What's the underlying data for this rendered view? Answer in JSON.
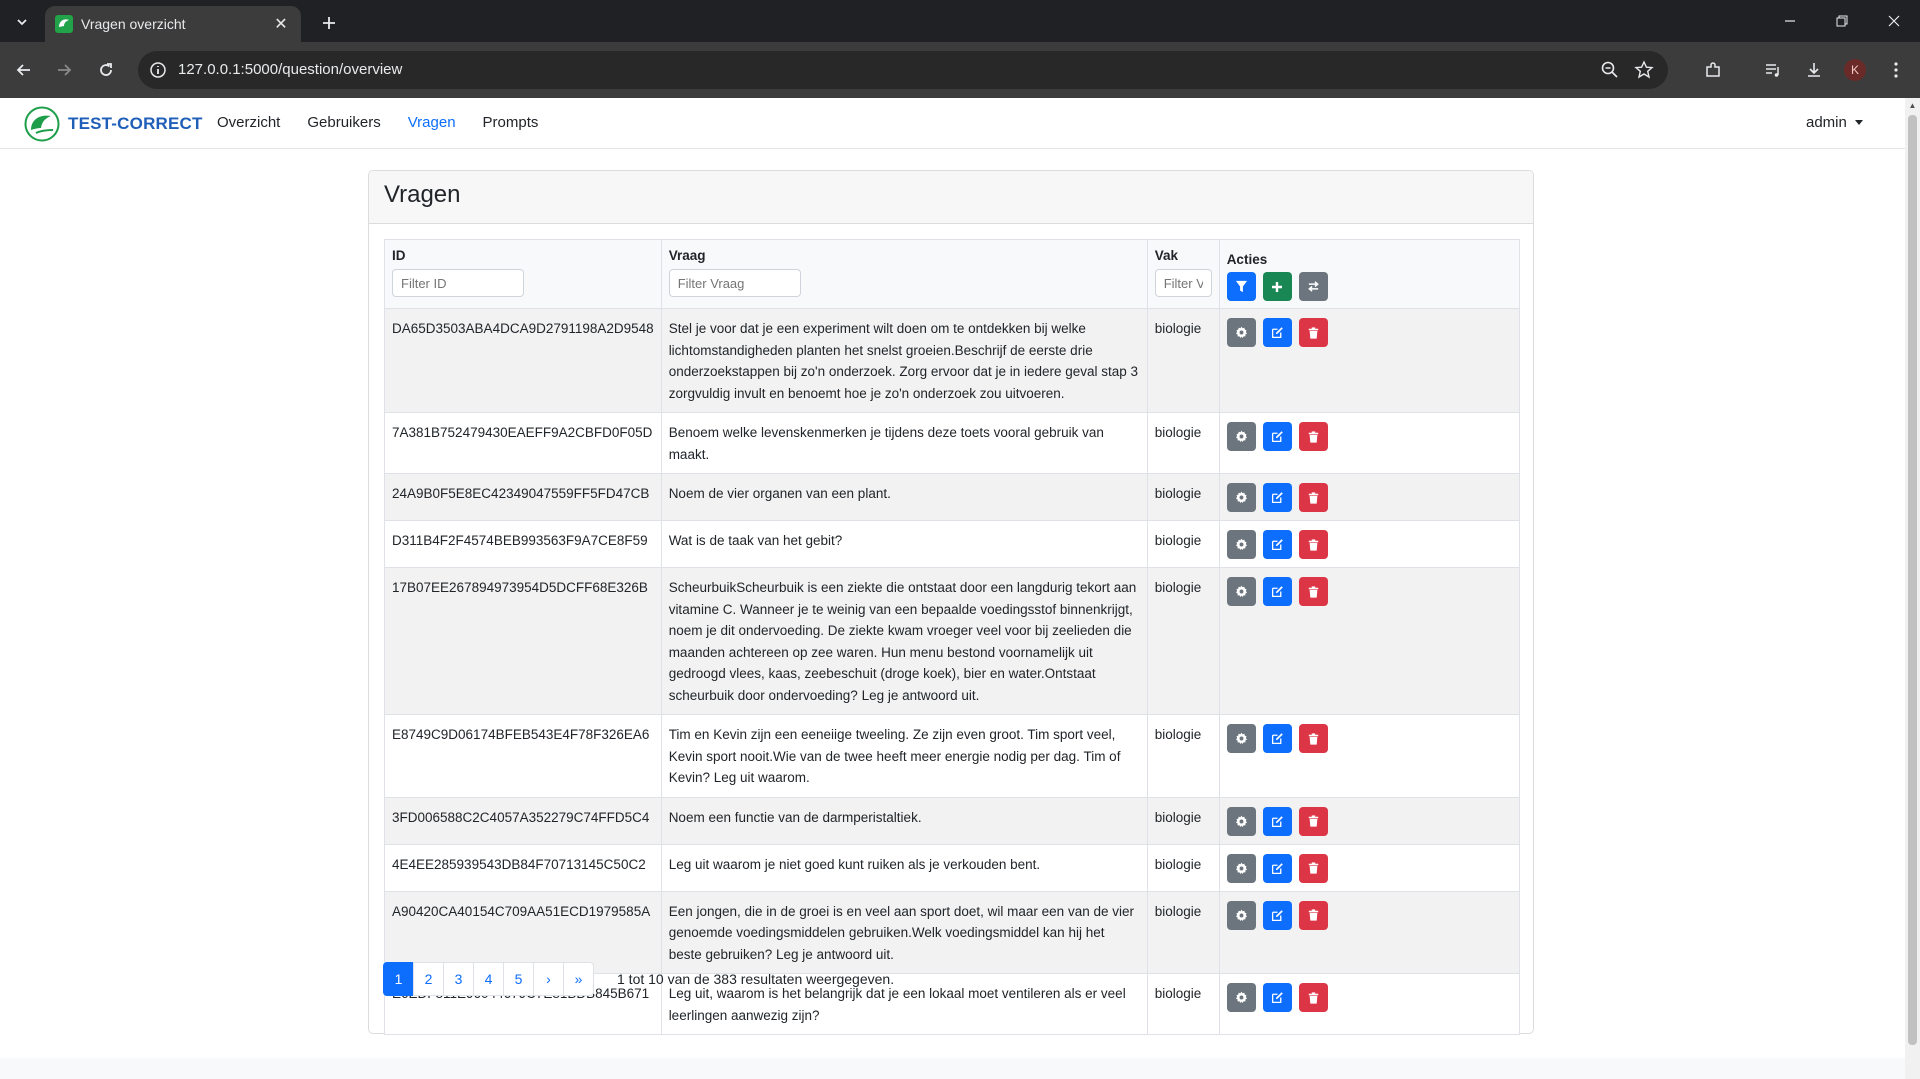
{
  "browser": {
    "tab_title": "Vragen overzicht",
    "url": "127.0.0.1:5000/question/overview",
    "profile_initial": "K"
  },
  "app": {
    "brand": "TEST-CORRECT",
    "nav": [
      {
        "label": "Overzicht",
        "active": false
      },
      {
        "label": "Gebruikers",
        "active": false
      },
      {
        "label": "Vragen",
        "active": true
      },
      {
        "label": "Prompts",
        "active": false
      }
    ],
    "user": "admin"
  },
  "page": {
    "title": "Vragen",
    "columns": {
      "id": "ID",
      "question": "Vraag",
      "subject": "Vak",
      "actions": "Acties"
    },
    "filters": {
      "id_placeholder": "Filter ID",
      "question_placeholder": "Filter Vraag",
      "subject_placeholder": "Filter Vak"
    },
    "rows": [
      {
        "id": "DA65D3503ABA4DCA9D2791198A2D9548",
        "question": "Stel je voor dat je een experiment wilt doen om te ontdekken bij welke lichtomstandigheden planten het snelst groeien.Beschrijf de eerste drie onderzoekstappen bij zo'n onderzoek. Zorg ervoor dat je in iedere geval stap 3 zorgvuldig invult en benoemt hoe je zo'n onderzoek zou uitvoeren.",
        "subject": "biologie"
      },
      {
        "id": "7A381B752479430EAEFF9A2CBFD0F05D",
        "question": "Benoem welke levenskenmerken je tijdens deze toets vooral gebruik van maakt.",
        "subject": "biologie"
      },
      {
        "id": "24A9B0F5E8EC42349047559FF5FD47CB",
        "question": "Noem de vier organen van een plant.",
        "subject": "biologie"
      },
      {
        "id": "D311B4F2F4574BEB993563F9A7CE8F59",
        "question": "Wat is de taak van het gebit?",
        "subject": "biologie"
      },
      {
        "id": "17B07EE267894973954D5DCFF68E326B",
        "question": "ScheurbuikScheurbuik is een ziekte die ontstaat door een langdurig tekort aan vitamine C. Wanneer je te weinig van een bepaalde voedingsstof binnenkrijgt, noem je dit ondervoeding. De ziekte kwam vroeger veel voor bij zeelieden die maanden achtereen op zee waren. Hun menu bestond voornamelijk uit gedroogd vlees, kaas, zeebeschuit (droge koek), bier en water.Ontstaat scheurbuik door ondervoeding? Leg je antwoord uit.",
        "subject": "biologie"
      },
      {
        "id": "E8749C9D06174BFEB543E4F78F326EA6",
        "question": "Tim en Kevin zijn een eeneiige tweeling. Ze zijn even groot. Tim sport veel, Kevin sport nooit.Wie van de twee heeft meer energie nodig per dag. Tim of Kevin? Leg uit waarom.",
        "subject": "biologie"
      },
      {
        "id": "3FD006588C2C4057A352279C74FFD5C4",
        "question": "Noem een functie van de darmperistaltiek.",
        "subject": "biologie"
      },
      {
        "id": "4E4EE285939543DB84F70713145C50C2",
        "question": "Leg uit waarom je niet goed kunt ruiken als je verkouden bent.",
        "subject": "biologie"
      },
      {
        "id": "A90420CA40154C709AA51ECD1979585A",
        "question": "Een jongen, die in de groei is en veel aan sport doet, wil maar een van de vier genoemde voedingsmiddelen gebruiken.Welk voedingsmiddel kan hij het beste gebruiken? Leg je antwoord uit.",
        "subject": "biologie"
      },
      {
        "id": "E6EDF811E96044679C7E81BDB845B671",
        "question": "Leg uit, waarom is het belangrijk dat je een lokaal moet ventileren als er veel leerlingen aanwezig zijn?",
        "subject": "biologie"
      }
    ],
    "pagination": [
      "1",
      "2",
      "3",
      "4",
      "5",
      "›",
      "»"
    ],
    "current_page": "1",
    "result_info": "1 tot 10 van de 383 resultaten weergegeven."
  },
  "colors": {
    "primary": "#0d6efd",
    "success": "#198754",
    "secondary": "#6c757d",
    "danger": "#dc3545"
  },
  "icons": {
    "filter": "funnel-icon",
    "add": "plus-icon",
    "swap": "arrows-swap-icon",
    "settings": "gear-icon",
    "edit": "edit-icon",
    "delete": "trash-icon"
  }
}
